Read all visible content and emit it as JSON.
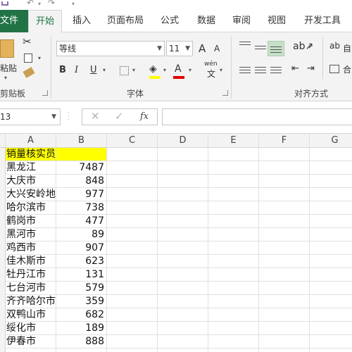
{
  "ribbon": {
    "tabs": [
      "文件",
      "开始",
      "插入",
      "页面布局",
      "公式",
      "数据",
      "审阅",
      "视图",
      "开发工具"
    ],
    "active_tab": "开始",
    "clipboard": {
      "paste_label": "粘贴",
      "group_label": "剪贴板"
    },
    "font": {
      "font_name": "等线",
      "font_size": "11",
      "bold": "B",
      "italic": "I",
      "underline": "U",
      "grow": "A",
      "shrink": "A",
      "wen": "wén",
      "wen_char": "文",
      "group_label": "字体"
    },
    "alignment": {
      "group_label": "对齐方式",
      "wrap_partial": "自",
      "merge_partial": "合"
    }
  },
  "formula_bar": {
    "name_box": "13",
    "cancel": "✕",
    "enter": "✓",
    "fx": "fx",
    "value": ""
  },
  "sheet": {
    "columns": [
      "A",
      "B",
      "C",
      "D",
      "E",
      "F",
      "G"
    ],
    "header_cell": "销量核实员刘大柱",
    "rows": [
      {
        "city": "黑龙江",
        "value": "7487"
      },
      {
        "city": "大庆市",
        "value": "848"
      },
      {
        "city": "大兴安岭地区",
        "value": "977"
      },
      {
        "city": "哈尔滨市",
        "value": "738"
      },
      {
        "city": "鹤岗市",
        "value": "477"
      },
      {
        "city": "黑河市",
        "value": "89"
      },
      {
        "city": "鸡西市",
        "value": "907"
      },
      {
        "city": "佳木斯市",
        "value": "623"
      },
      {
        "city": "牡丹江市",
        "value": "131"
      },
      {
        "city": "七台河市",
        "value": "579"
      },
      {
        "city": "齐齐哈尔市",
        "value": "359"
      },
      {
        "city": "双鸭山市",
        "value": "682"
      },
      {
        "city": "绥化市",
        "value": "189"
      },
      {
        "city": "伊春市",
        "value": "888"
      }
    ]
  },
  "colors": {
    "accent": "#217346",
    "header_fill": "#ffff00",
    "ribbon_bg": "#f3f3f3"
  }
}
